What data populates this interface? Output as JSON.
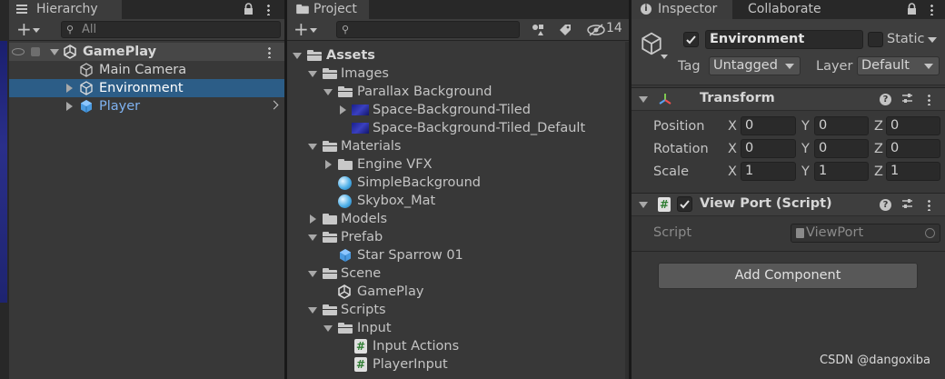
{
  "hierarchy": {
    "tab_label": "Hierarchy",
    "search_placeholder": "All",
    "scene_name": "GamePlay",
    "items": [
      "Main Camera",
      "Environment",
      "Player"
    ]
  },
  "project": {
    "tab_label": "Project",
    "hidden_count": "14",
    "tree": {
      "assets": "Assets",
      "images": "Images",
      "parallax": "Parallax Background",
      "tiled": "Space-Background-Tiled",
      "tiled_default": "Space-Background-Tiled_Default",
      "materials": "Materials",
      "engine_vfx": "Engine VFX",
      "simple_bg": "SimpleBackground",
      "skybox": "Skybox_Mat",
      "models": "Models",
      "prefab": "Prefab",
      "star_sparrow": "Star Sparrow 01",
      "scene": "Scene",
      "gameplay": "GamePlay",
      "scripts": "Scripts",
      "input": "Input",
      "input_actions": "Input Actions",
      "player_input": "PlayerInput"
    }
  },
  "inspector": {
    "tab_label": "Inspector",
    "collab_tab_label": "Collaborate",
    "object_name": "Environment",
    "static_label": "Static",
    "tag_label": "Tag",
    "tag_value": "Untagged",
    "layer_label": "Layer",
    "layer_value": "Default",
    "transform": {
      "title": "Transform",
      "position_label": "Position",
      "rotation_label": "Rotation",
      "scale_label": "Scale",
      "x": "X",
      "y": "Y",
      "z": "Z",
      "position": [
        "0",
        "0",
        "0"
      ],
      "rotation": [
        "0",
        "0",
        "0"
      ],
      "scale": [
        "1",
        "1",
        "1"
      ]
    },
    "viewport": {
      "title": "View Port (Script)",
      "script_label": "Script",
      "script_value": "ViewPort"
    },
    "add_component_label": "Add Component"
  },
  "watermark": "CSDN @dangoxiba",
  "colors": {
    "selection": "#2c5d87",
    "prefab_blue": "#7fb2f0",
    "panel_bg": "#383838"
  }
}
